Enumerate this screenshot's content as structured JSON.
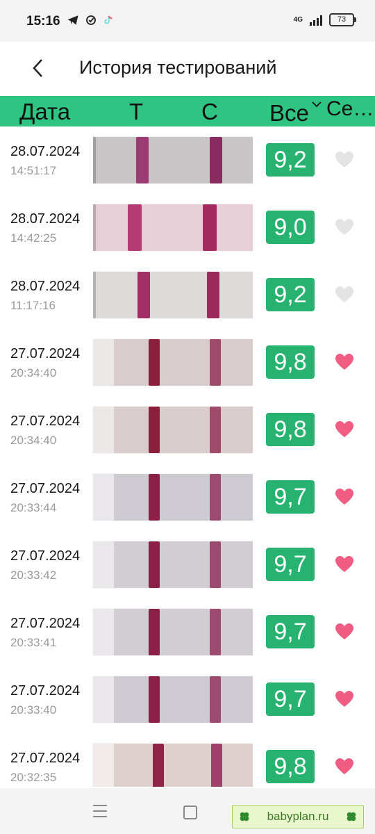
{
  "status_bar": {
    "time": "15:16",
    "network": "4G",
    "battery": "73"
  },
  "header": {
    "title": "История тестирований"
  },
  "columns": {
    "date": "Дата",
    "t": "Т",
    "c": "С",
    "all": "Все",
    "fav": "Се…"
  },
  "rows": [
    {
      "date": "28.07.2024",
      "time": "14:51:17",
      "score": "9,2",
      "fav": false,
      "bg": "#c9c4c6",
      "t_color": "#9c3a73",
      "c_color": "#8c2a62"
    },
    {
      "date": "28.07.2024",
      "time": "14:42:25",
      "score": "9,0",
      "fav": false,
      "bg": "#e8ced6",
      "t_color": "#b53a74",
      "c_color": "#a42a60"
    },
    {
      "date": "28.07.2024",
      "time": "11:17:16",
      "score": "9,2",
      "fav": false,
      "bg": "#dedad9",
      "t_color": "#a02f63",
      "c_color": "#9a2a5c"
    },
    {
      "date": "27.07.2024",
      "time": "20:34:40",
      "score": "9,8",
      "fav": true,
      "bg": "#d8cccd",
      "t_color": "#8a1f3c",
      "c_color": "#9e4a68"
    },
    {
      "date": "27.07.2024",
      "time": "20:34:40",
      "score": "9,8",
      "fav": true,
      "bg": "#d8cccd",
      "t_color": "#8a1f3c",
      "c_color": "#9e4a68"
    },
    {
      "date": "27.07.2024",
      "time": "20:33:44",
      "score": "9,7",
      "fav": true,
      "bg": "#cfcbd3",
      "t_color": "#8a2046",
      "c_color": "#9c4a70"
    },
    {
      "date": "27.07.2024",
      "time": "20:33:42",
      "score": "9,7",
      "fav": true,
      "bg": "#d2ccd3",
      "t_color": "#8a2046",
      "c_color": "#9c4a70"
    },
    {
      "date": "27.07.2024",
      "time": "20:33:41",
      "score": "9,7",
      "fav": true,
      "bg": "#d2ccd3",
      "t_color": "#8a2046",
      "c_color": "#9c4a70"
    },
    {
      "date": "27.07.2024",
      "time": "20:33:40",
      "score": "9,7",
      "fav": true,
      "bg": "#d0cbd2",
      "t_color": "#8a2046",
      "c_color": "#9c4a70"
    },
    {
      "date": "27.07.2024",
      "time": "20:32:35",
      "score": "9,8",
      "fav": true,
      "bg": "#ddd0cd",
      "t_color": "#8e2448",
      "c_color": "#a0406a"
    }
  ],
  "colors": {
    "accent": "#2fc482",
    "score_bg": "#27b36f",
    "heart_on": "#f25b82",
    "heart_off": "#e3e3e3"
  },
  "icons": {
    "back": "chevron-left-icon",
    "sort": "chevron-down-icon",
    "heart": "heart-icon",
    "clover": "clover-icon"
  },
  "watermark": {
    "text": "babyplan.ru"
  }
}
